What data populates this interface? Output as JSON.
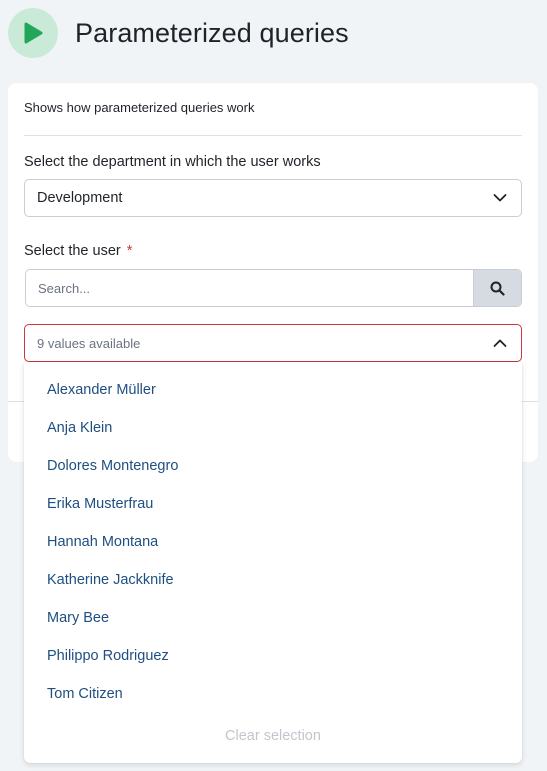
{
  "header": {
    "title": "Parameterized queries",
    "icon": "play-icon",
    "accent": "#22a75a"
  },
  "card": {
    "description": "Shows how parameterized queries work",
    "department": {
      "label": "Select the department in which the user works",
      "value": "Development"
    },
    "user": {
      "label": "Select the user",
      "required_mark": "*",
      "search_placeholder": "Search...",
      "select_text": "9 values available",
      "options": [
        "Alexander Müller",
        "Anja Klein",
        "Dolores Montenegro",
        "Erika Musterfrau",
        "Hannah Montana",
        "Katherine Jackknife",
        "Mary Bee",
        "Philippo Rodriguez",
        "Tom Citizen"
      ],
      "clear_label": "Clear selection"
    }
  },
  "colors": {
    "error_border": "#d0343c",
    "link": "#1e4f80",
    "icon_bg": "#c9ead7"
  }
}
